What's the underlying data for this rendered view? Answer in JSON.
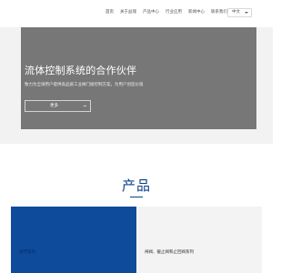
{
  "nav": {
    "items": [
      {
        "label": "首页"
      },
      {
        "label": "关于益瑞"
      },
      {
        "label": "产品中心"
      },
      {
        "label": "行业应用"
      },
      {
        "label": "新闻中心"
      },
      {
        "label": "联系我们"
      }
    ],
    "language": "中文"
  },
  "hero": {
    "title": "流体控制系统的合作伙伴",
    "subtitle": "致力为全球用户提供高品质工业阀门级控制方案，为用户创造价值",
    "more_label": "更多",
    "arrow": "→"
  },
  "products": {
    "title": "产品",
    "cards": [
      {
        "label": "调节系列"
      },
      {
        "label": "闸阀、截止阀和止回阀系列"
      }
    ]
  }
}
